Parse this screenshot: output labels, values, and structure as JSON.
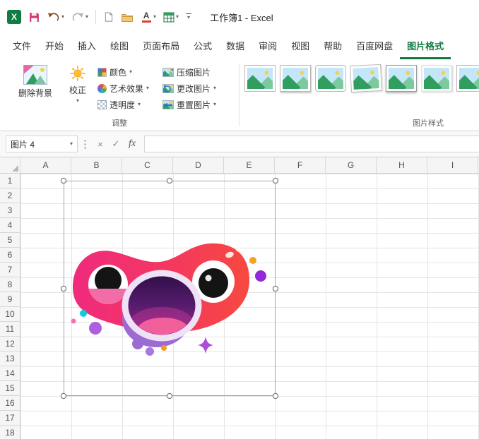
{
  "icons": {
    "excel_logo": "X",
    "chevron_down": "▾",
    "cancel": "×",
    "enter": "✓",
    "font_color_letter": "A"
  },
  "titlebar": {
    "title": "工作簿1 - Excel"
  },
  "tabs": [
    "文件",
    "开始",
    "插入",
    "绘图",
    "页面布局",
    "公式",
    "数据",
    "审阅",
    "视图",
    "帮助",
    "百度网盘",
    "图片格式"
  ],
  "ribbon": {
    "buttons": {
      "remove_background": "删除背景",
      "corrections": "校正",
      "color": "颜色",
      "artistic_effects": "艺术效果",
      "transparency": "透明度",
      "compress_picture": "压缩图片",
      "change_picture": "更改图片",
      "reset_picture": "重置图片"
    },
    "groups": {
      "adjust": "调整",
      "picture_styles": "图片样式"
    }
  },
  "formula_bar": {
    "name_box_value": "图片 4",
    "fx_label": "fx",
    "formula_value": ""
  },
  "grid": {
    "columns": [
      "A",
      "B",
      "C",
      "D",
      "E",
      "F",
      "G",
      "H",
      "I"
    ],
    "rows": [
      "1",
      "2",
      "3",
      "4",
      "5",
      "6",
      "7",
      "8",
      "9",
      "10",
      "11",
      "12",
      "13",
      "14",
      "15",
      "16",
      "17",
      "18"
    ]
  },
  "colors": {
    "accent_green": "#107C41",
    "face_gradient_left": "#F02A7E",
    "face_gradient_right": "#F7493F",
    "mouth_outline": "#EFE2F7",
    "mouth_dark": "#2E0E45",
    "chin_purple": "#9B6BD3",
    "sparkle_purple": "#AC4FD6"
  }
}
